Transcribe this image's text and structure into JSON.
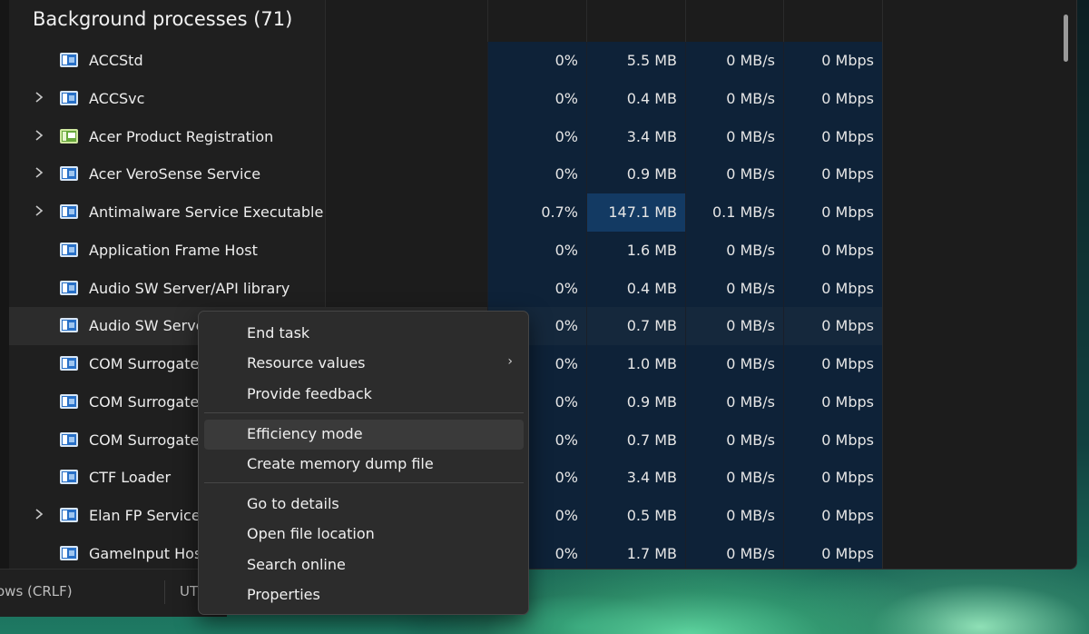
{
  "task_manager": {
    "section_title": "Background processes (71)",
    "processes": [
      {
        "name": "ACCStd",
        "expandable": false,
        "icon": "app-window-icon",
        "cpu": "0%",
        "memory": "5.5 MB",
        "disk": "0 MB/s",
        "network": "0 Mbps"
      },
      {
        "name": "ACCSvc",
        "expandable": true,
        "icon": "app-window-icon",
        "cpu": "0%",
        "memory": "0.4 MB",
        "disk": "0 MB/s",
        "network": "0 Mbps"
      },
      {
        "name": "Acer Product Registration",
        "expandable": true,
        "icon": "acer-registration-icon",
        "cpu": "0%",
        "memory": "3.4 MB",
        "disk": "0 MB/s",
        "network": "0 Mbps"
      },
      {
        "name": "Acer VeroSense Service",
        "expandable": true,
        "icon": "app-window-icon",
        "cpu": "0%",
        "memory": "0.9 MB",
        "disk": "0 MB/s",
        "network": "0 Mbps"
      },
      {
        "name": "Antimalware Service Executable",
        "expandable": true,
        "icon": "app-window-icon",
        "cpu": "0.7%",
        "memory": "147.1 MB",
        "disk": "0.1 MB/s",
        "network": "0 Mbps",
        "memory_highlight": true
      },
      {
        "name": "Application Frame Host",
        "expandable": false,
        "icon": "app-window-icon",
        "cpu": "0%",
        "memory": "1.6 MB",
        "disk": "0 MB/s",
        "network": "0 Mbps"
      },
      {
        "name": "Audio SW Server/API library",
        "expandable": false,
        "icon": "app-window-icon",
        "cpu": "0%",
        "memory": "0.4 MB",
        "disk": "0 MB/s",
        "network": "0 Mbps"
      },
      {
        "name": "Audio SW Serve",
        "expandable": false,
        "icon": "app-window-icon",
        "cpu": "0%",
        "memory": "0.7 MB",
        "disk": "0 MB/s",
        "network": "0 Mbps",
        "selected": true
      },
      {
        "name": "COM Surrogate",
        "expandable": false,
        "icon": "app-window-icon",
        "cpu": "0%",
        "memory": "1.0 MB",
        "disk": "0 MB/s",
        "network": "0 Mbps"
      },
      {
        "name": "COM Surrogate",
        "expandable": false,
        "icon": "app-window-icon",
        "cpu": "0%",
        "memory": "0.9 MB",
        "disk": "0 MB/s",
        "network": "0 Mbps"
      },
      {
        "name": "COM Surrogate",
        "expandable": false,
        "icon": "app-window-icon",
        "cpu": "0%",
        "memory": "0.7 MB",
        "disk": "0 MB/s",
        "network": "0 Mbps"
      },
      {
        "name": "CTF Loader",
        "expandable": false,
        "icon": "app-window-icon",
        "cpu": "0%",
        "memory": "3.4 MB",
        "disk": "0 MB/s",
        "network": "0 Mbps"
      },
      {
        "name": "Elan FP Service",
        "expandable": true,
        "icon": "app-window-icon",
        "cpu": "0%",
        "memory": "0.5 MB",
        "disk": "0 MB/s",
        "network": "0 Mbps"
      },
      {
        "name": "GameInput Hos",
        "expandable": false,
        "icon": "app-window-icon",
        "cpu": "0%",
        "memory": "1.7 MB",
        "disk": "0 MB/s",
        "network": "0 Mbps"
      }
    ]
  },
  "context_menu": {
    "groups": [
      [
        {
          "label": "End task",
          "name": "end-task"
        },
        {
          "label": "Resource values",
          "name": "resource-values",
          "submenu": true
        },
        {
          "label": "Provide feedback",
          "name": "provide-feedback"
        }
      ],
      [
        {
          "label": "Efficiency mode",
          "name": "efficiency-mode",
          "hover": true
        },
        {
          "label": "Create memory dump file",
          "name": "create-memory-dump-file"
        }
      ],
      [
        {
          "label": "Go to details",
          "name": "go-to-details"
        },
        {
          "label": "Open file location",
          "name": "open-file-location"
        },
        {
          "label": "Search online",
          "name": "search-online"
        },
        {
          "label": "Properties",
          "name": "properties"
        }
      ]
    ],
    "submenu_glyph": "›"
  },
  "background_app_statusbar": {
    "line_ending": "ows (CRLF)",
    "encoding": "UT"
  },
  "colors": {
    "window_bg": "#1c1c1c",
    "heat_cell": "#0e2238",
    "heat_cell_hot": "#133a63",
    "menu_bg": "#2c2c2c"
  }
}
